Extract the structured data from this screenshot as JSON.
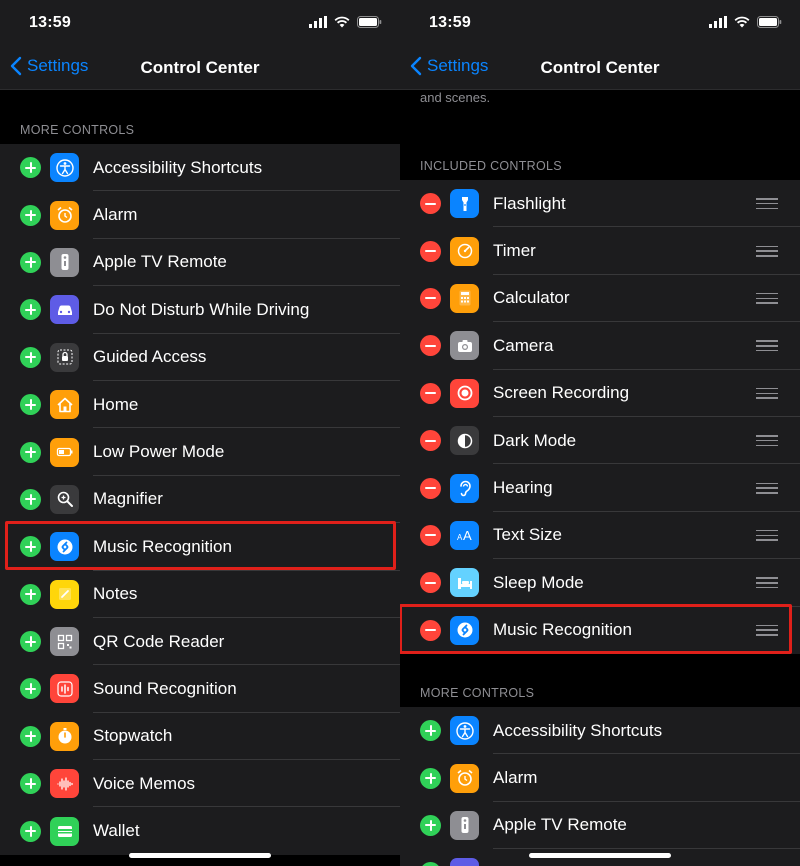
{
  "status": {
    "time": "13:59"
  },
  "nav": {
    "back_label": "Settings",
    "title": "Control Center"
  },
  "left": {
    "more_header": "MORE CONTROLS",
    "more_controls": [
      {
        "label": "Accessibility Shortcuts",
        "icon": "accessibility-icon",
        "color": "#0a84ff"
      },
      {
        "label": "Alarm",
        "icon": "alarm-icon",
        "color": "#ff9f0a"
      },
      {
        "label": "Apple TV Remote",
        "icon": "remote-icon",
        "color": "#8e8e93"
      },
      {
        "label": "Do Not Disturb While Driving",
        "icon": "car-icon",
        "color": "#5e5ce6"
      },
      {
        "label": "Guided Access",
        "icon": "lock-icon",
        "color": "#3a3a3c"
      },
      {
        "label": "Home",
        "icon": "home-icon",
        "color": "#ff9f0a"
      },
      {
        "label": "Low Power Mode",
        "icon": "battery-icon",
        "color": "#ff9f0a"
      },
      {
        "label": "Magnifier",
        "icon": "magnifier-icon",
        "color": "#3a3a3c"
      },
      {
        "label": "Music Recognition",
        "icon": "shazam-icon",
        "color": "#0a84ff"
      },
      {
        "label": "Notes",
        "icon": "notes-icon",
        "color": "#ffd60a"
      },
      {
        "label": "QR Code Reader",
        "icon": "qr-code-icon",
        "color": "#8e8e93"
      },
      {
        "label": "Sound Recognition",
        "icon": "sound-recognition-icon",
        "color": "#ff453a"
      },
      {
        "label": "Stopwatch",
        "icon": "stopwatch-icon",
        "color": "#ff9f0a"
      },
      {
        "label": "Voice Memos",
        "icon": "voice-memos-icon",
        "color": "#ff453a"
      },
      {
        "label": "Wallet",
        "icon": "wallet-icon",
        "color": "#30d158"
      }
    ]
  },
  "right": {
    "top_text": "and scenes.",
    "included_header": "INCLUDED CONTROLS",
    "included_controls": [
      {
        "label": "Flashlight",
        "icon": "flashlight-icon",
        "color": "#0a84ff"
      },
      {
        "label": "Timer",
        "icon": "timer-icon",
        "color": "#ff9f0a"
      },
      {
        "label": "Calculator",
        "icon": "calculator-icon",
        "color": "#ff9f0a"
      },
      {
        "label": "Camera",
        "icon": "camera-icon",
        "color": "#8e8e93"
      },
      {
        "label": "Screen Recording",
        "icon": "screen-recording-icon",
        "color": "#ff453a"
      },
      {
        "label": "Dark Mode",
        "icon": "dark-mode-icon",
        "color": "#3a3a3c"
      },
      {
        "label": "Hearing",
        "icon": "ear-icon",
        "color": "#0a84ff"
      },
      {
        "label": "Text Size",
        "icon": "text-size-icon",
        "color": "#0a84ff"
      },
      {
        "label": "Sleep Mode",
        "icon": "bed-icon",
        "color": "#64d2ff"
      },
      {
        "label": "Music Recognition",
        "icon": "shazam-icon",
        "color": "#0a84ff"
      }
    ],
    "more_header": "MORE CONTROLS",
    "more_controls": [
      {
        "label": "Accessibility Shortcuts",
        "icon": "accessibility-icon",
        "color": "#0a84ff"
      },
      {
        "label": "Alarm",
        "icon": "alarm-icon",
        "color": "#ff9f0a"
      },
      {
        "label": "Apple TV Remote",
        "icon": "remote-icon",
        "color": "#8e8e93"
      },
      {
        "label": "",
        "icon": "car-icon",
        "color": "#5e5ce6"
      }
    ]
  },
  "colors": {
    "accent": "#0a84ff",
    "add": "#30d158",
    "remove": "#ff453a",
    "highlight": "#e0201a"
  }
}
